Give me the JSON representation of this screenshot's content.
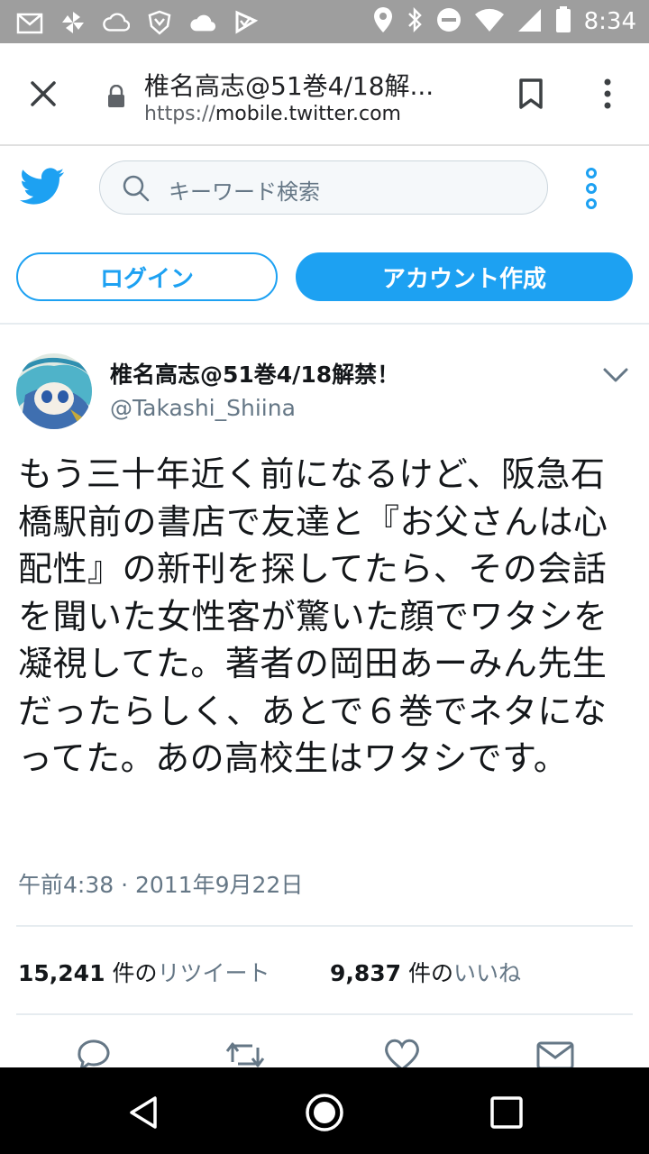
{
  "status_bar": {
    "time": "8:34",
    "icons_left": [
      "mail-icon",
      "pinwheel-icon",
      "cloud-sync-icon",
      "shield-icon",
      "cloud-icon",
      "check-flag-icon"
    ],
    "icons_right": [
      "location-icon",
      "bluetooth-icon",
      "do-not-disturb-icon",
      "wifi-icon",
      "cell-signal-icon",
      "battery-icon"
    ]
  },
  "browser": {
    "page_title": "椎名高志@51巻4/18解...",
    "url_scheme": "https://",
    "url_host": "mobile.twitter.com"
  },
  "twitter_header": {
    "search_placeholder": "キーワード検索",
    "login_label": "ログイン",
    "signup_label": "アカウント作成",
    "brand_color": "#1da1f2"
  },
  "tweet": {
    "author_name": "椎名高志@51巻4/18解禁！",
    "author_handle": "@Takashi_Shiina",
    "body": "もう三十年近く前になるけど、阪急石橋駅前の書店で友達と『お父さんは心配性』の新刊を探してたら、その会話を聞いた女性客が驚いた顔でワタシを凝視してた。著者の岡田あーみん先生だったらしく、あとで６巻でネタになってた。あの高校生はワタシです。",
    "timestamp": "午前4:38 · 2011年9月22日",
    "retweet_count": "15,241",
    "retweet_unit": "件の",
    "retweet_label": "リツイート",
    "like_count": "9,837",
    "like_unit": "件の",
    "like_label": "いいね"
  },
  "nav_bar": {
    "buttons": [
      "back-icon",
      "home-icon",
      "recents-icon"
    ]
  }
}
